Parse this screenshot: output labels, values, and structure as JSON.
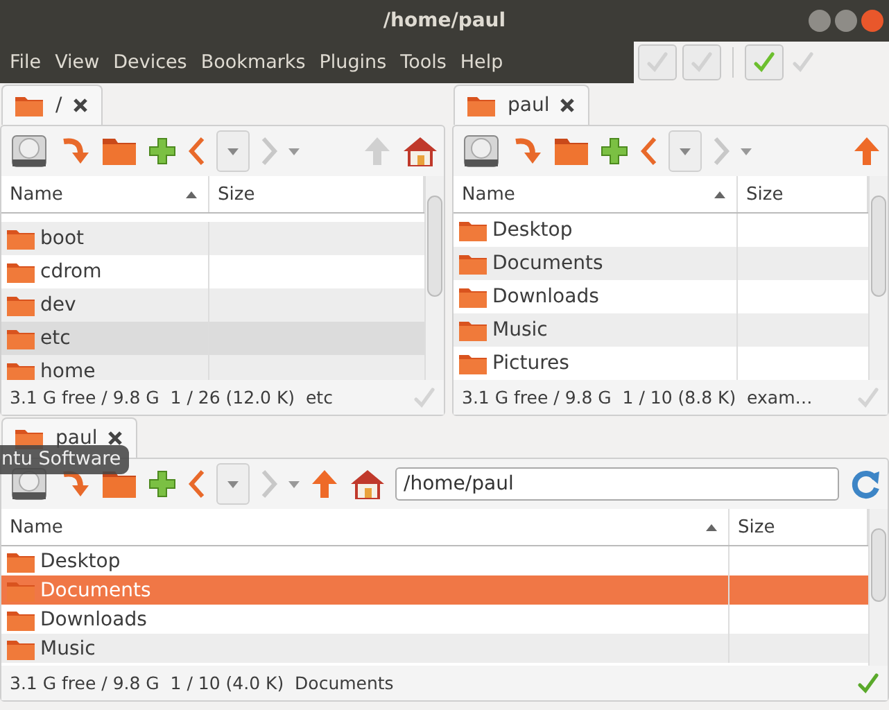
{
  "window": {
    "title": "/home/paul"
  },
  "menu": [
    "File",
    "View",
    "Devices",
    "Bookmarks",
    "Plugins",
    "Tools",
    "Help"
  ],
  "quick_buttons": [
    {
      "kind": "framed",
      "disabled": true
    },
    {
      "kind": "framed",
      "disabled": true
    },
    {
      "kind": "framed",
      "disabled": false
    },
    {
      "kind": "plain",
      "disabled": true
    }
  ],
  "panes": [
    {
      "tab": "/",
      "focused": false,
      "up_disabled": true,
      "home": true,
      "columns": [
        "Name",
        "Size"
      ],
      "rows": [
        {
          "name": "boot",
          "selected": false
        },
        {
          "name": "cdrom",
          "selected": false
        },
        {
          "name": "dev",
          "selected": false
        },
        {
          "name": "etc",
          "selected": true
        },
        {
          "name": "home",
          "selected": false
        }
      ],
      "status": "3.1 G free / 9.8 G  1 / 26 (12.0 K)  etc"
    },
    {
      "tab": "paul",
      "focused": false,
      "up_disabled": false,
      "home": false,
      "columns": [
        "Name",
        "Size"
      ],
      "rows": [
        {
          "name": "Desktop",
          "selected": false
        },
        {
          "name": "Documents",
          "selected": false
        },
        {
          "name": "Downloads",
          "selected": false
        },
        {
          "name": "Music",
          "selected": false
        },
        {
          "name": "Pictures",
          "selected": false
        }
      ],
      "status": "3.1 G free / 9.8 G  1 / 10 (8.8 K)  exam…"
    },
    {
      "tab": "paul",
      "focused": true,
      "up_disabled": false,
      "home": true,
      "path": "/home/paul",
      "columns": [
        "Name",
        "Size"
      ],
      "rows": [
        {
          "name": "Desktop",
          "selected": false
        },
        {
          "name": "Documents",
          "selected": true
        },
        {
          "name": "Downloads",
          "selected": false
        },
        {
          "name": "Music",
          "selected": false
        }
      ],
      "status": "3.1 G free / 9.8 G  1 / 10 (4.0 K)  Documents"
    }
  ],
  "tooltip": "ntu Software"
}
